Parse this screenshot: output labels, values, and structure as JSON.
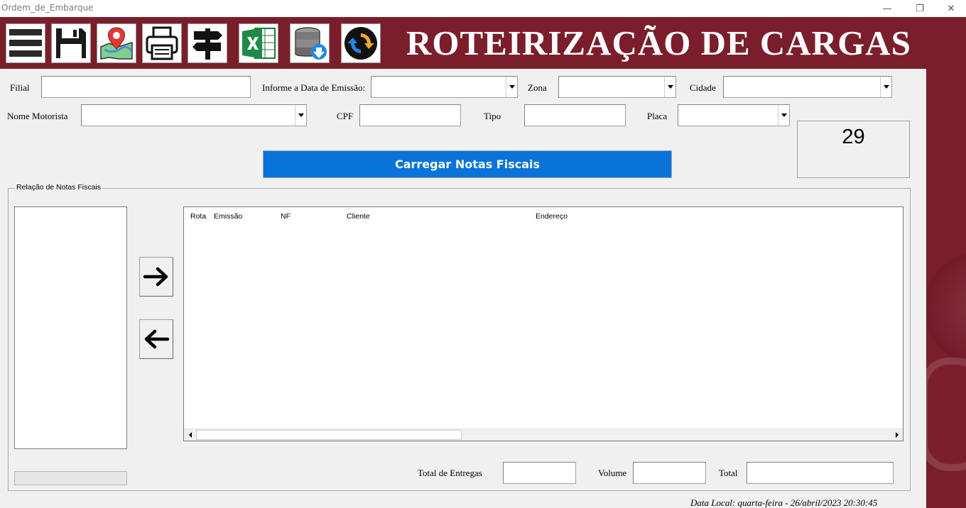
{
  "window": {
    "title": "Ordem_de_Embarque",
    "minimize": "—",
    "restore": "❐",
    "close": "✕"
  },
  "header": {
    "title": "ROTEIRIZAÇÃO DE CARGAS",
    "toolbar": [
      {
        "name": "menu-icon"
      },
      {
        "name": "save-icon"
      },
      {
        "name": "map-pin-icon"
      },
      {
        "name": "printer-icon"
      },
      {
        "name": "signpost-icon"
      },
      {
        "name": "excel-icon"
      },
      {
        "name": "database-download-icon"
      },
      {
        "name": "refresh-icon"
      }
    ],
    "colors": {
      "brand": "#7b1e2c",
      "button_blue": "#0a73d9"
    }
  },
  "form": {
    "filial_label": "Filial",
    "filial_value": "",
    "data_emissao_label": "Informe a Data de Emissão:",
    "data_emissao_value": "",
    "zona_label": "Zona",
    "zona_value": "",
    "cidade_label": "Cidade",
    "cidade_value": "",
    "motorista_label": "Nome Motorista",
    "motorista_value": "",
    "cpf_label": "CPF",
    "cpf_value": "",
    "tipo_label": "Tipo",
    "tipo_value": "",
    "placa_label": "Placa",
    "placa_value": "",
    "counter": "29",
    "load_button": "Carregar Notas Fiscais"
  },
  "notas": {
    "group_title": "Relação de Notas Fiscais",
    "columns": [
      "Rota",
      "Emissão",
      "NF",
      "Cliente",
      "Endereço"
    ],
    "rows": []
  },
  "totals": {
    "entregas_label": "Total de Entregas",
    "entregas_value": "",
    "volume_label": "Volume",
    "volume_value": "",
    "total_label": "Total",
    "total_value": ""
  },
  "footer": {
    "date": "Data Local: quarta-feira - 26/abril/2023 20:30:45"
  }
}
